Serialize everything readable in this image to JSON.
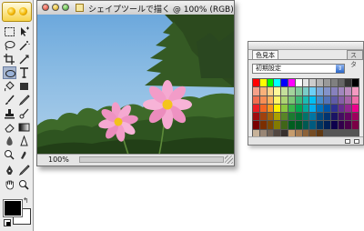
{
  "document": {
    "title": "シェイプツールで描く @ 100% (RGB)",
    "zoom": "100%"
  },
  "color_palette": {
    "tab_active": "色見本",
    "tab_inactive": "スタ",
    "preset": "初期設定",
    "swatches": [
      "#ff0000",
      "#ffff00",
      "#00ff00",
      "#00ffff",
      "#0000ff",
      "#ff00ff",
      "#ffffff",
      "#e6e6e6",
      "#cccccc",
      "#b3b3b3",
      "#999999",
      "#808080",
      "#666666",
      "#333333",
      "#000000",
      "#f6a089",
      "#f9b17a",
      "#fbd28a",
      "#fff799",
      "#c4df9b",
      "#a3d39c",
      "#82ca9c",
      "#7accc8",
      "#6dcff6",
      "#7da7d8",
      "#8393ca",
      "#8781bd",
      "#a187be",
      "#bd8cbf",
      "#f49ac1",
      "#f26c4f",
      "#f68e55",
      "#fbaf5c",
      "#fff467",
      "#acd372",
      "#7cc576",
      "#3bb878",
      "#1abbb4",
      "#00bff3",
      "#438ccb",
      "#5574b9",
      "#605ca8",
      "#855fa8",
      "#a763a8",
      "#f06ea9",
      "#ed1c24",
      "#f26522",
      "#f7941d",
      "#fff200",
      "#8dc73f",
      "#39b54a",
      "#00a651",
      "#00a99d",
      "#00aeef",
      "#0072bc",
      "#0054a6",
      "#2e3192",
      "#662d91",
      "#92278f",
      "#ec008c",
      "#9e0b0f",
      "#a0410d",
      "#a36209",
      "#aba000",
      "#598527",
      "#1a7b30",
      "#007236",
      "#00746b",
      "#0076a3",
      "#004a80",
      "#003471",
      "#1b1464",
      "#440e62",
      "#630460",
      "#9e005d",
      "#790000",
      "#7b2e00",
      "#7d4900",
      "#827b00",
      "#406618",
      "#005e20",
      "#005826",
      "#005952",
      "#005b7f",
      "#003663",
      "#002157",
      "#0d004c",
      "#32004b",
      "#4b0049",
      "#7b0046",
      "#c7b299",
      "#998675",
      "#736357",
      "#534741",
      "#37302d",
      "#c69c6d",
      "#a67c52",
      "#8c6239",
      "#754c24",
      "#603913"
    ]
  },
  "tools": {
    "foreground": "#000000",
    "background": "#ffffff"
  }
}
